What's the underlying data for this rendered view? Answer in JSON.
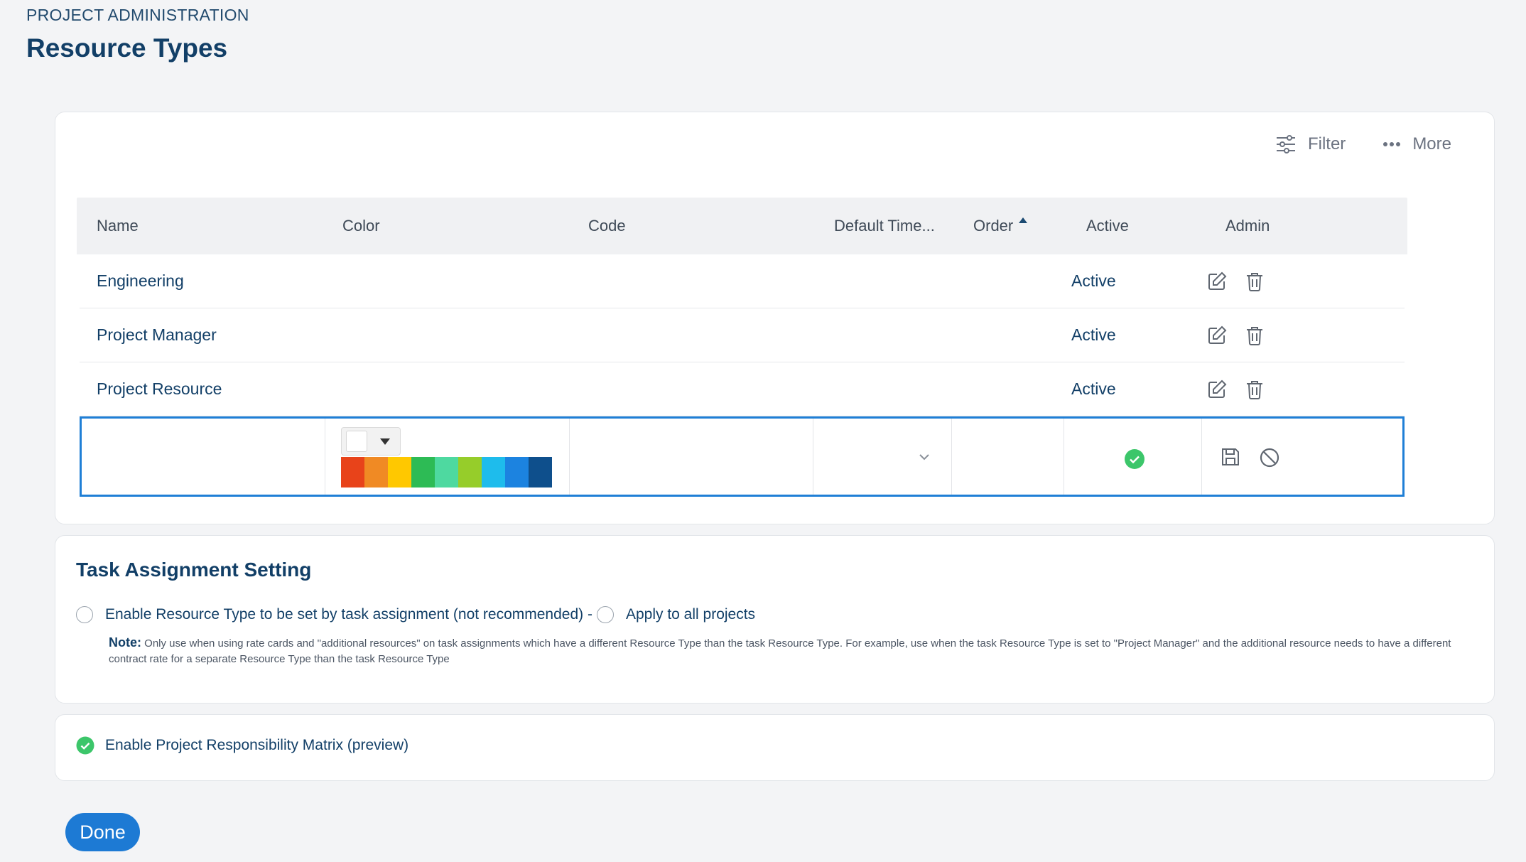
{
  "header": {
    "breadcrumb": "PROJECT ADMINISTRATION",
    "title": "Resource Types"
  },
  "toolbar": {
    "filter_label": "Filter",
    "more_label": "More"
  },
  "table": {
    "columns": [
      "Name",
      "Color",
      "Code",
      "Default Time...",
      "Order",
      "Active",
      "Admin"
    ],
    "sorted_column": "Order",
    "sort_direction": "ascending",
    "rows": [
      {
        "name": "Engineering",
        "color": "",
        "code": "",
        "default_time": "",
        "order": "",
        "active": "Active"
      },
      {
        "name": "Project Manager",
        "color": "",
        "code": "",
        "default_time": "",
        "order": "",
        "active": "Active"
      },
      {
        "name": "Project Resource",
        "color": "",
        "code": "",
        "default_time": "",
        "order": "",
        "active": "Active"
      }
    ],
    "edit_row": {
      "name_value": "",
      "selected_color": "#ffffff",
      "palette": [
        "#e8431a",
        "#f08a24",
        "#ffc800",
        "#2dbb55",
        "#4ed9a0",
        "#96cd2a",
        "#1ebcec",
        "#1c83e0",
        "#0e4f8c"
      ],
      "active_checked": true
    }
  },
  "task_assignment": {
    "title": "Task Assignment Setting",
    "option_label": "Enable Resource Type to be set by task assignment (not recommended) -",
    "apply_all_label": "Apply to all projects",
    "note_label": "Note:",
    "note_text": "Only use when using rate cards and \"additional resources\" on task assignments which have a different Resource Type than the task Resource Type. For example, use when the task Resource Type is set to \"Project Manager\" and the additional resource needs to have a different contract rate for a separate Resource Type than the task Resource Type"
  },
  "matrix": {
    "label": "Enable Project Responsibility Matrix (preview)",
    "checked": true
  },
  "footer": {
    "done_label": "Done"
  },
  "colors": {
    "accent": "#1d7ad4",
    "success": "#3cc66a",
    "text_primary": "#123f67"
  }
}
